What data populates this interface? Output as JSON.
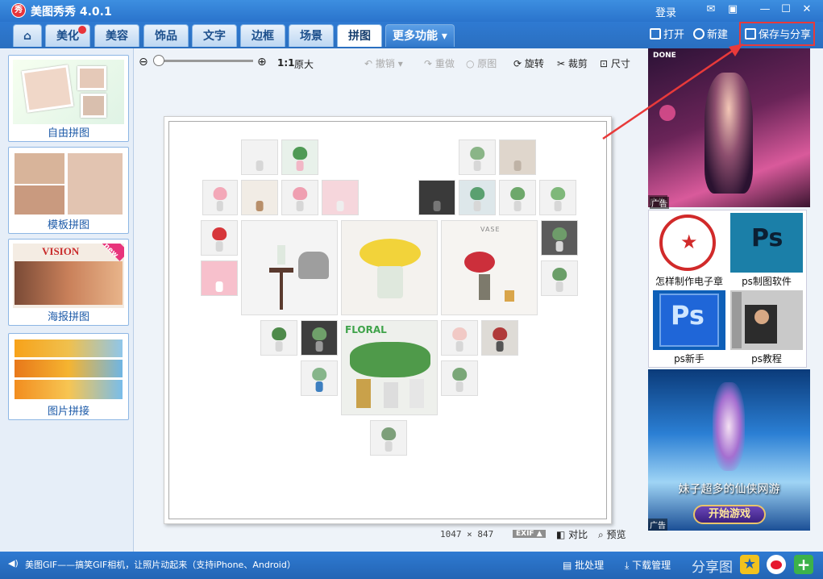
{
  "app": {
    "title": "美图秀秀 4.0.1",
    "logo_text": "秀",
    "login": "登录"
  },
  "window_controls": {
    "feedback": "✉",
    "skin": "▣",
    "minimize": "—",
    "maximize": "☐",
    "close": "✕"
  },
  "nav": {
    "home_label": "⌂",
    "tabs": [
      "美化",
      "美容",
      "饰品",
      "文字",
      "边框",
      "场景",
      "拼图"
    ],
    "active_tab": "拼图",
    "more": "更多功能 ▾",
    "open": "打开",
    "new": "新建",
    "save_share": "保存与分享"
  },
  "left_modes": [
    {
      "label": "自由拼图"
    },
    {
      "label": "模板拼图"
    },
    {
      "label": "海报拼图",
      "thumb_text": "VISION",
      "badge": "new"
    },
    {
      "label": "图片拼接"
    }
  ],
  "toolbar": {
    "zoom_ratio": "1:1",
    "original_size": "原大",
    "undo": "撤销",
    "redo": "重做",
    "original": "原图",
    "rotate": "旋转",
    "crop": "裁剪",
    "size": "尺寸"
  },
  "canvas": {
    "floral_text": "FLORAL",
    "vase_text": "VASE",
    "width_px": "1047",
    "times": "×",
    "height_px": "847"
  },
  "canvas_actions": {
    "exif": "EXIF ▲",
    "compare": "对比",
    "preview": "预览"
  },
  "ads": {
    "ad_label": "广告",
    "top_ad_tag": "DONE",
    "grid": [
      {
        "label": "怎样制作电子章"
      },
      {
        "label": "ps制图软件"
      },
      {
        "label": "ps新手"
      },
      {
        "label": "ps教程"
      }
    ],
    "ps_logo": "Ps",
    "bottom_ad_text": "妹子超多的仙侠网游",
    "bottom_ad_button": "开始游戏"
  },
  "bottom": {
    "marquee": "美图GIF——搞笑GIF相机，让照片动起来（支持iPhone、Android）",
    "batch": "批处理",
    "download": "下载管理",
    "share": "分享图"
  },
  "colors": {
    "accent_red": "#e83a3a",
    "brand_blue": "#2a6fc0"
  }
}
